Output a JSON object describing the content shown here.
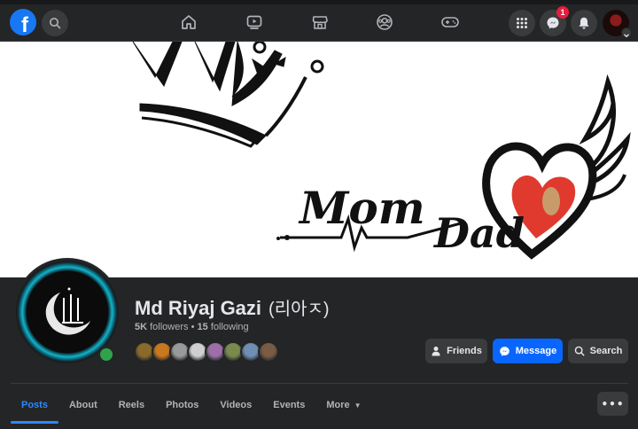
{
  "nav": {
    "logo_letter": "f",
    "messenger_badge": "1"
  },
  "profile": {
    "name": "Md Riyaj Gazi",
    "alt_name": "(리아ㅈ)",
    "followers": "5K",
    "followers_label": "followers",
    "separator": "•",
    "following": "15",
    "following_label": "following",
    "friend_face_colors": [
      "#8a6a2a",
      "#c9781f",
      "#9a9a9a",
      "#cfcfcf",
      "#9c6fa8",
      "#7a8a4c",
      "#6e8fb3",
      "#7a5c44"
    ]
  },
  "actions": {
    "friends_label": "Friends",
    "message_label": "Message",
    "search_label": "Search"
  },
  "tabs": [
    {
      "label": "Posts"
    },
    {
      "label": "About"
    },
    {
      "label": "Reels"
    },
    {
      "label": "Photos"
    },
    {
      "label": "Videos"
    },
    {
      "label": "Events"
    },
    {
      "label": "More"
    }
  ],
  "cover": {
    "mom_text": "Mom",
    "dad_text": "Dad"
  },
  "colors": {
    "brand": "#1877f2",
    "message_button": "#0866ff",
    "active_tab": "#2d88ff",
    "online": "#31a24c",
    "badge": "#e41e3f"
  }
}
